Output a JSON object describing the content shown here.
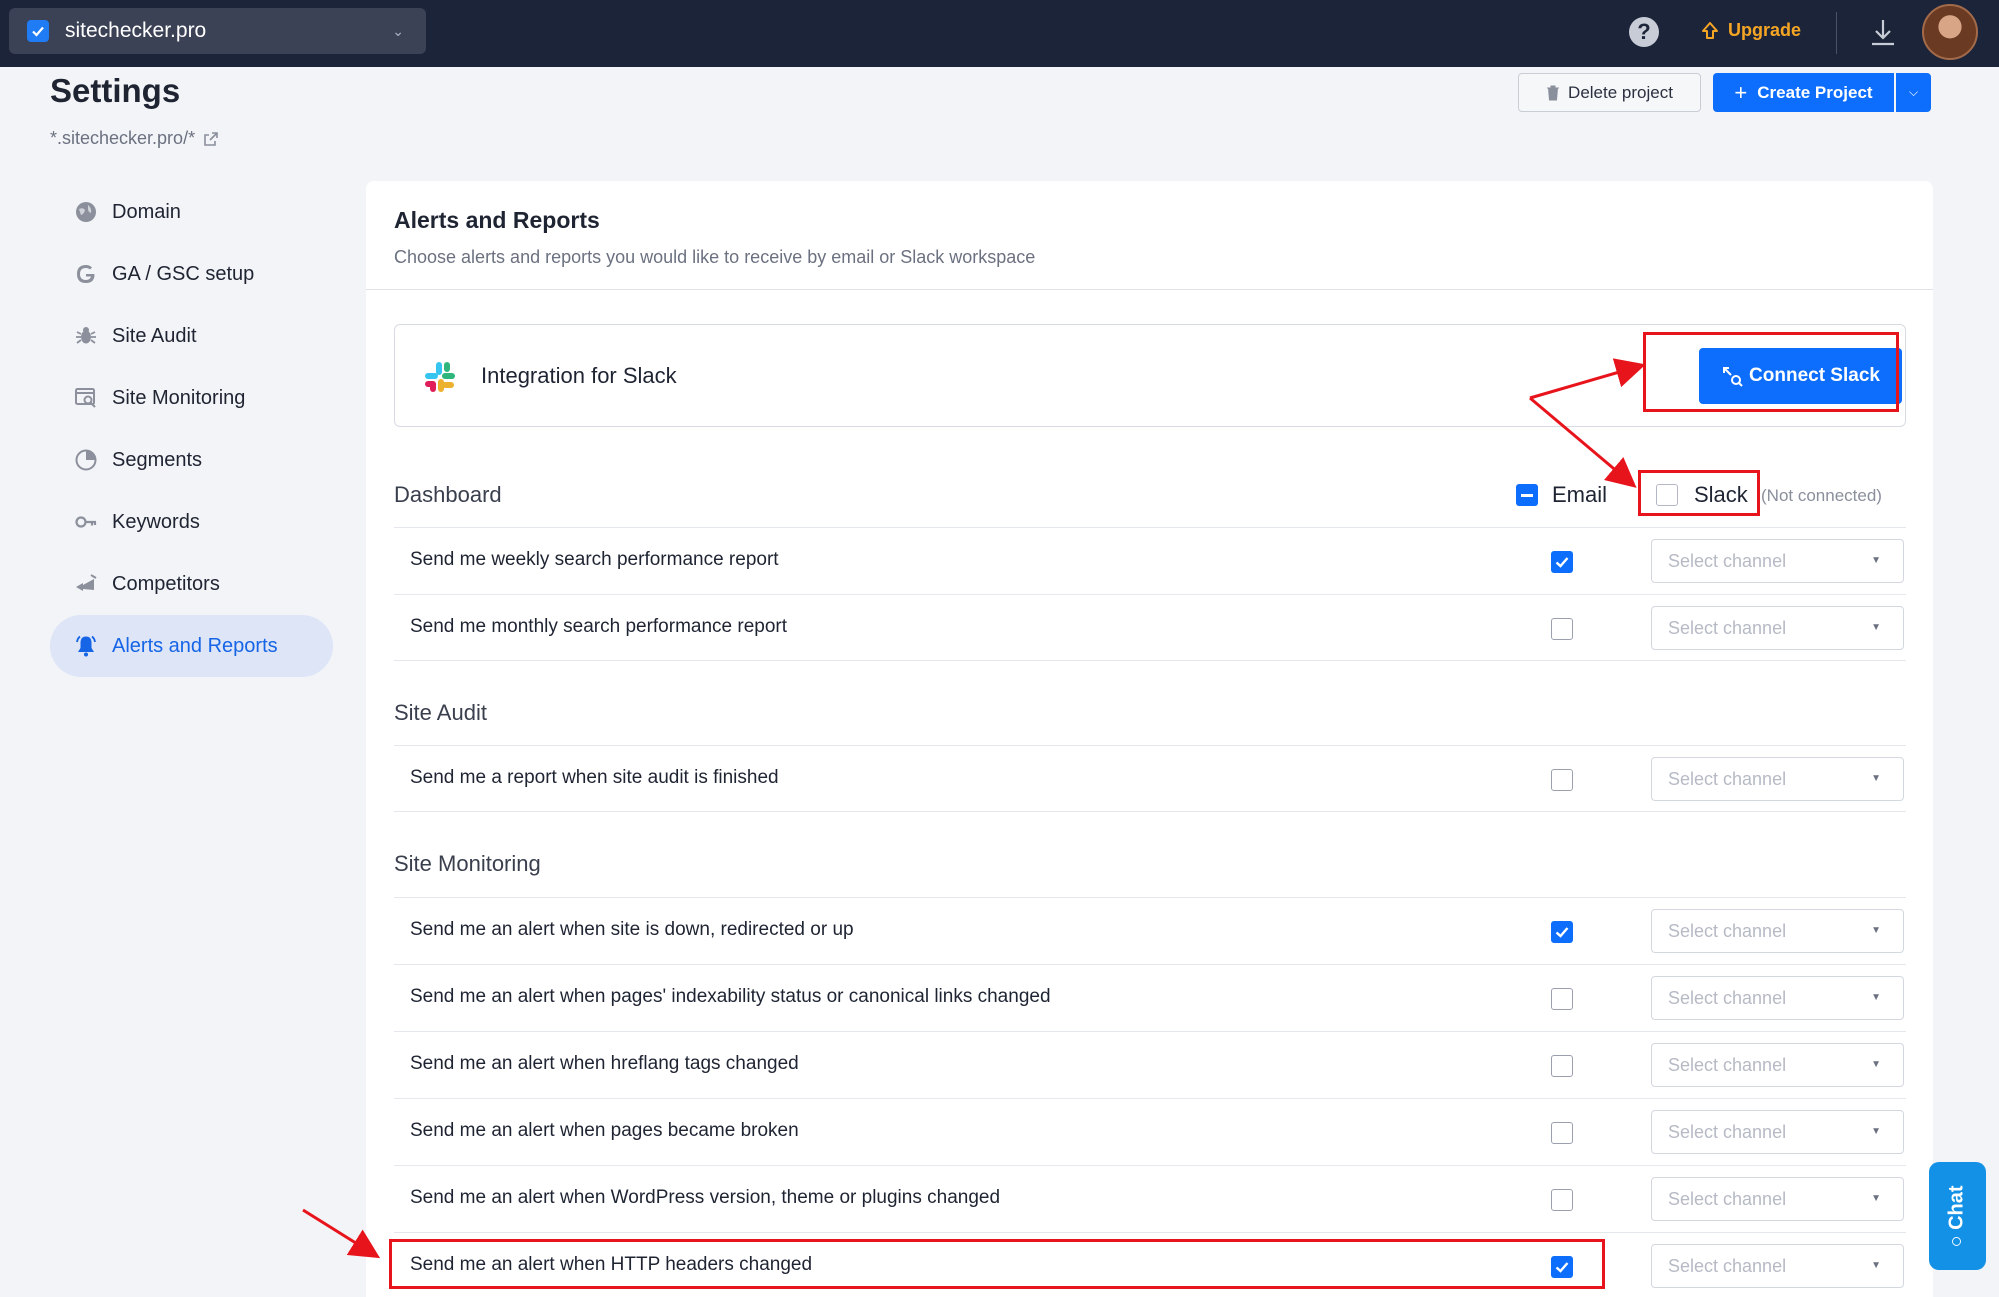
{
  "topbar": {
    "project_name": "sitechecker.pro",
    "upgrade_label": "Upgrade"
  },
  "header": {
    "title": "Settings",
    "subtitle": "*.sitechecker.pro/*",
    "delete_label": "Delete project",
    "create_label": "Create Project"
  },
  "sidebar": {
    "items": [
      {
        "label": "Domain",
        "icon": "globe-icon"
      },
      {
        "label": "GA / GSC setup",
        "icon": "google-icon"
      },
      {
        "label": "Site Audit",
        "icon": "bug-icon"
      },
      {
        "label": "Site Monitoring",
        "icon": "monitor-icon"
      },
      {
        "label": "Segments",
        "icon": "pie-icon"
      },
      {
        "label": "Keywords",
        "icon": "key-icon"
      },
      {
        "label": "Competitors",
        "icon": "competitors-icon"
      },
      {
        "label": "Alerts and Reports",
        "icon": "bell-icon"
      }
    ]
  },
  "panel": {
    "title": "Alerts and Reports",
    "description": "Choose alerts and reports you would like to receive by email or Slack workspace",
    "slack_integration_label": "Integration for Slack",
    "connect_slack_label": "Connect Slack",
    "columns": {
      "email": "Email",
      "slack": "Slack",
      "not_connected": "(Not connected)"
    },
    "channel_placeholder": "Select channel",
    "sections": [
      {
        "title": "Dashboard",
        "rows": [
          {
            "label": "Send me weekly search performance report",
            "email": true
          },
          {
            "label": "Send me monthly search performance report",
            "email": false
          }
        ]
      },
      {
        "title": "Site Audit",
        "rows": [
          {
            "label": "Send me a report when site audit is finished",
            "email": false
          }
        ]
      },
      {
        "title": "Site Monitoring",
        "rows": [
          {
            "label": "Send me an alert when site is down, redirected or up",
            "email": true
          },
          {
            "label": "Send me an alert when pages' indexability status or canonical links changed",
            "email": false
          },
          {
            "label": "Send me an alert when hreflang tags changed",
            "email": false
          },
          {
            "label": "Send me an alert when pages became broken",
            "email": false
          },
          {
            "label": "Send me an alert when WordPress version, theme or plugins changed",
            "email": false
          },
          {
            "label": "Send me an alert when HTTP headers changed",
            "email": true
          }
        ]
      }
    ]
  },
  "chat_label": "Chat",
  "colors": {
    "topbar": "#1c2439",
    "accent": "#0d6efd",
    "annotation": "#e8141c"
  }
}
